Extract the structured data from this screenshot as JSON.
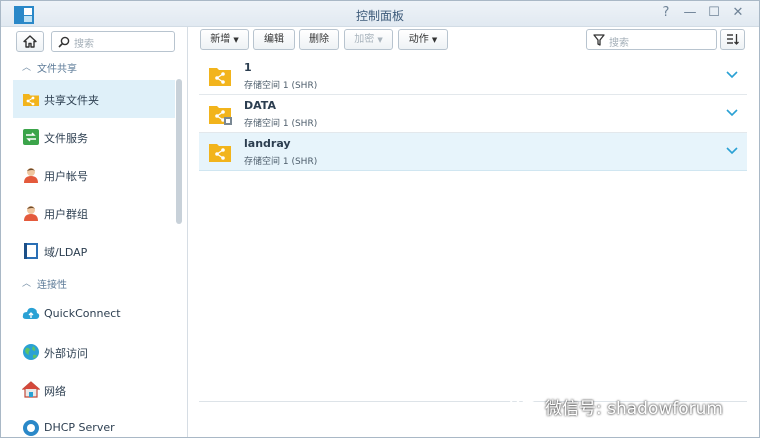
{
  "window": {
    "title": "控制面板",
    "controls": [
      "?",
      "—",
      "☐",
      "✕"
    ]
  },
  "sidebar": {
    "search_placeholder": "搜索",
    "sections": [
      {
        "label": "文件共享",
        "items": [
          {
            "label": "共享文件夹",
            "icon": "shared-folder-icon",
            "active": true
          },
          {
            "label": "文件服务",
            "icon": "file-services-icon"
          },
          {
            "label": "用户帐号",
            "icon": "user-icon"
          },
          {
            "label": "用户群组",
            "icon": "group-icon"
          },
          {
            "label": "域/LDAP",
            "icon": "domain-ldap-icon"
          }
        ]
      },
      {
        "label": "连接性",
        "items": [
          {
            "label": "QuickConnect",
            "icon": "quickconnect-icon"
          },
          {
            "label": "外部访问",
            "icon": "globe-icon"
          },
          {
            "label": "网络",
            "icon": "network-icon"
          },
          {
            "label": "DHCP Server",
            "icon": "dhcp-icon"
          }
        ]
      }
    ]
  },
  "toolbar": {
    "create_label": "新增",
    "edit_label": "编辑",
    "delete_label": "删除",
    "encrypt_label": "加密",
    "action_label": "动作",
    "filter_placeholder": "搜索"
  },
  "folders": [
    {
      "name": "1",
      "subtitle": "存储空间 1 (SHR)",
      "selected": false
    },
    {
      "name": "DATA",
      "subtitle": "存储空间 1 (SHR)",
      "selected": false
    },
    {
      "name": "landray",
      "subtitle": "存储空间 1 (SHR)",
      "selected": true
    }
  ],
  "watermark": {
    "text": "微信号: shadowforum"
  },
  "colors": {
    "accent": "#2aa1d4",
    "folder": "#f2b41c",
    "selected_row": "#e7f4fb"
  }
}
